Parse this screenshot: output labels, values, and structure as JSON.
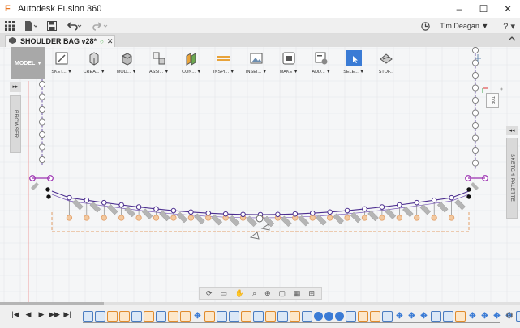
{
  "window": {
    "title": "Autodesk Fusion 360",
    "controls": {
      "minimize": "–",
      "maximize": "☐",
      "close": "✕"
    }
  },
  "quick_access": {
    "user": "Tim Deagan ▼",
    "help": "? ▾"
  },
  "document_tab": {
    "title": "SHOULDER BAG v28*",
    "status_icon": "○",
    "close": "✕"
  },
  "toolbar": {
    "workspace": "MODEL ▼",
    "tools": [
      {
        "label": "SKET... ▼",
        "icon": "sketch-icon"
      },
      {
        "label": "CREA... ▼",
        "icon": "create-icon"
      },
      {
        "label": "MOD... ▼",
        "icon": "modify-icon"
      },
      {
        "label": "ASSI... ▼",
        "icon": "assemble-icon"
      },
      {
        "label": "CON... ▼",
        "icon": "construct-icon"
      },
      {
        "label": "INSPI... ▼",
        "icon": "inspect-icon"
      },
      {
        "label": "INSEI... ▼",
        "icon": "insert-icon"
      },
      {
        "label": "MAKE ▼",
        "icon": "make-icon"
      },
      {
        "label": "ADD... ▼",
        "icon": "addins-icon"
      },
      {
        "label": "SELE... ▼",
        "icon": "select-icon"
      },
      {
        "label": "STOF...",
        "icon": "stop-sketch-icon"
      }
    ]
  },
  "panels": {
    "browser": "BROWSER",
    "sketch_palette": "SKETCH PALETTE",
    "expand_browser": "▸▸",
    "expand_palette": "◂◂"
  },
  "viewcube": {
    "face": "TOP"
  },
  "timeline": {
    "controls": [
      "|◀",
      "◀",
      "▶",
      "▶▶",
      "▶|"
    ],
    "settings": "⚙"
  },
  "colors": {
    "accent": "#3a7bd5",
    "sketch_line": "#4b2d8f",
    "constraint": "#9b30b0",
    "dimension": "#e3a06a"
  }
}
